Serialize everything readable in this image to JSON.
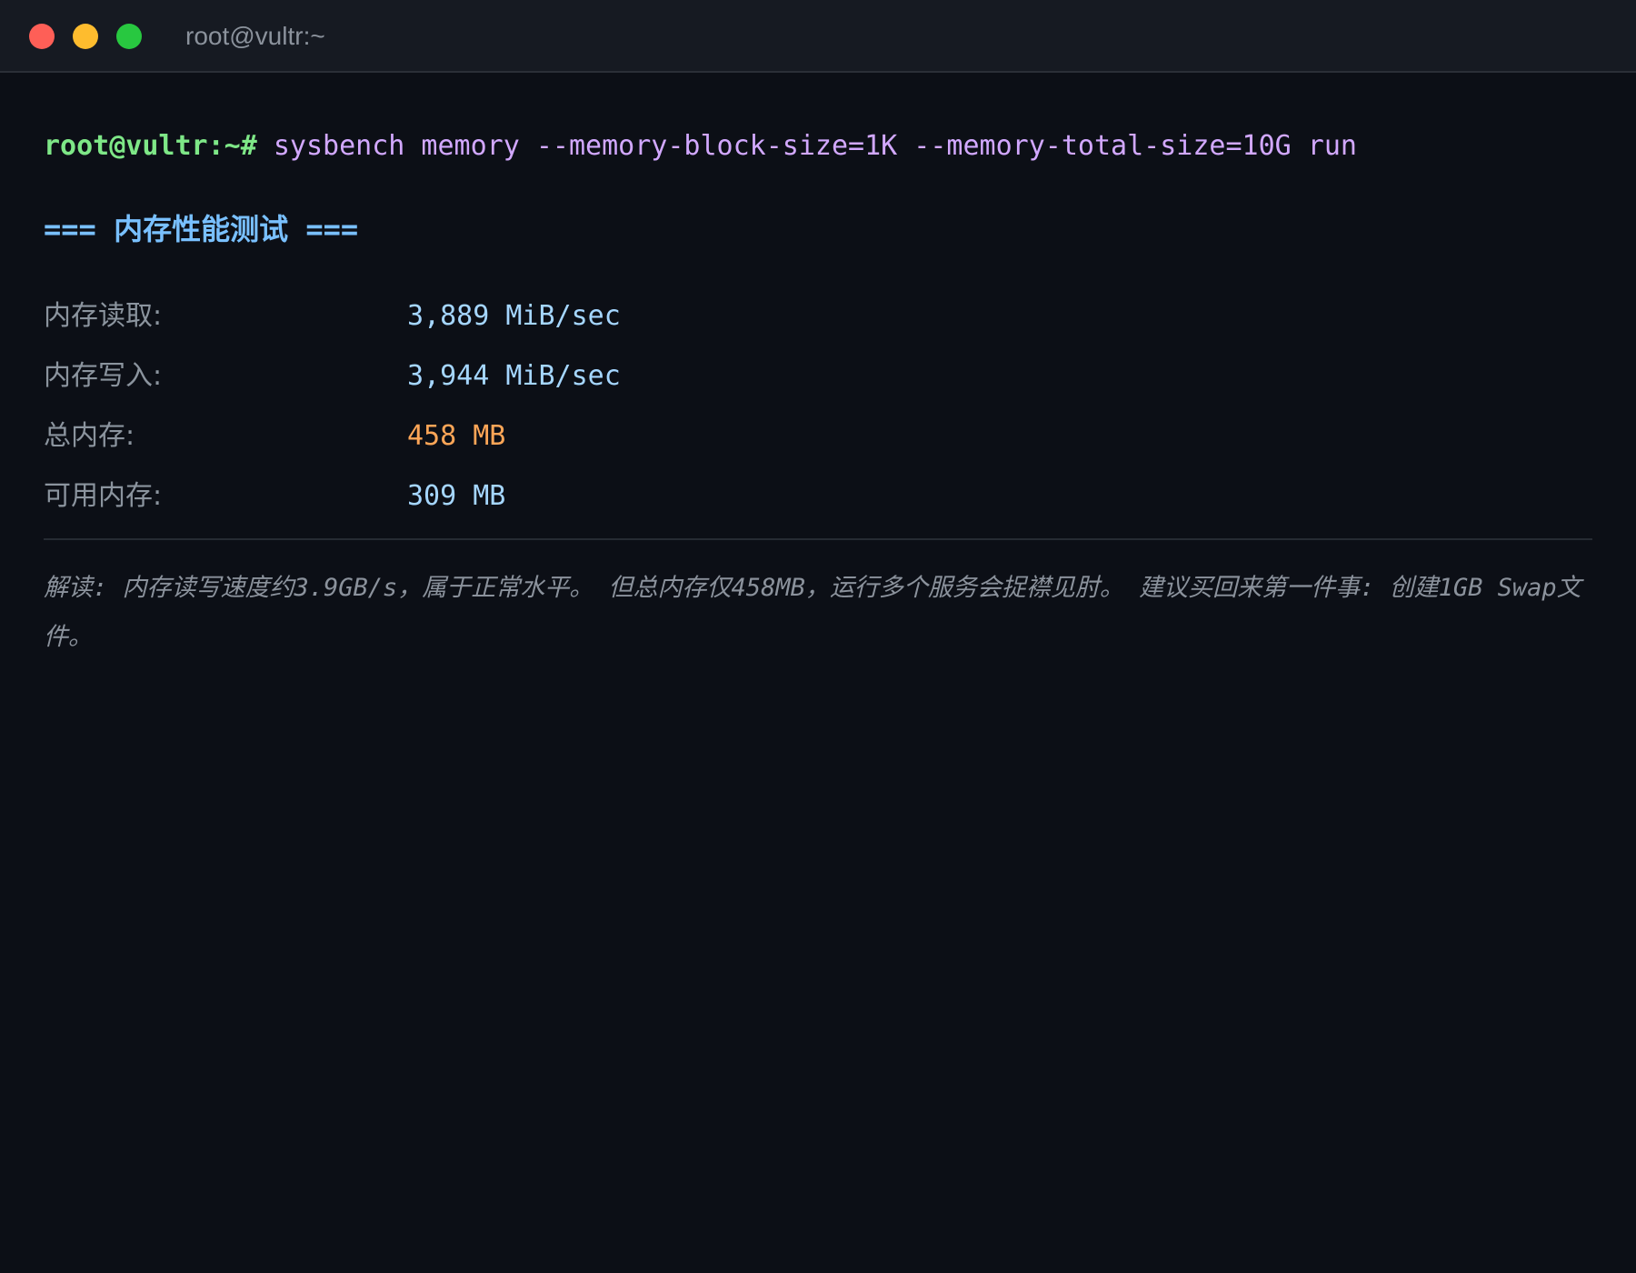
{
  "window": {
    "title": "root@vultr:~"
  },
  "terminal": {
    "prompt": "root@vultr:~#",
    "command": "sysbench memory --memory-block-size=1K --memory-total-size=10G run",
    "section_heading": "=== 内存性能测试 ===",
    "stats": [
      {
        "label": "内存读取:",
        "value": "3,889 MiB/sec",
        "color": "#a5d6ff"
      },
      {
        "label": "内存写入:",
        "value": "3,944 MiB/sec",
        "color": "#a5d6ff"
      },
      {
        "label": "总内存:",
        "value": "458 MB",
        "color": "#ffa657"
      },
      {
        "label": "可用内存:",
        "value": "309 MB",
        "color": "#a5d6ff"
      }
    ],
    "note": "解读: 内存读写速度约3.9GB/s，属于正常水平。 但总内存仅458MB，运行多个服务会捉襟见肘。 建议买回来第一件事: 创建1GB Swap文件。"
  },
  "colors": {
    "background": "#0c0f16",
    "titlebar": "#161a22",
    "prompt": "#7ee787",
    "command": "#d2a8ff",
    "heading": "#79c0ff",
    "label": "#8b949e",
    "note": "#8b929c"
  }
}
